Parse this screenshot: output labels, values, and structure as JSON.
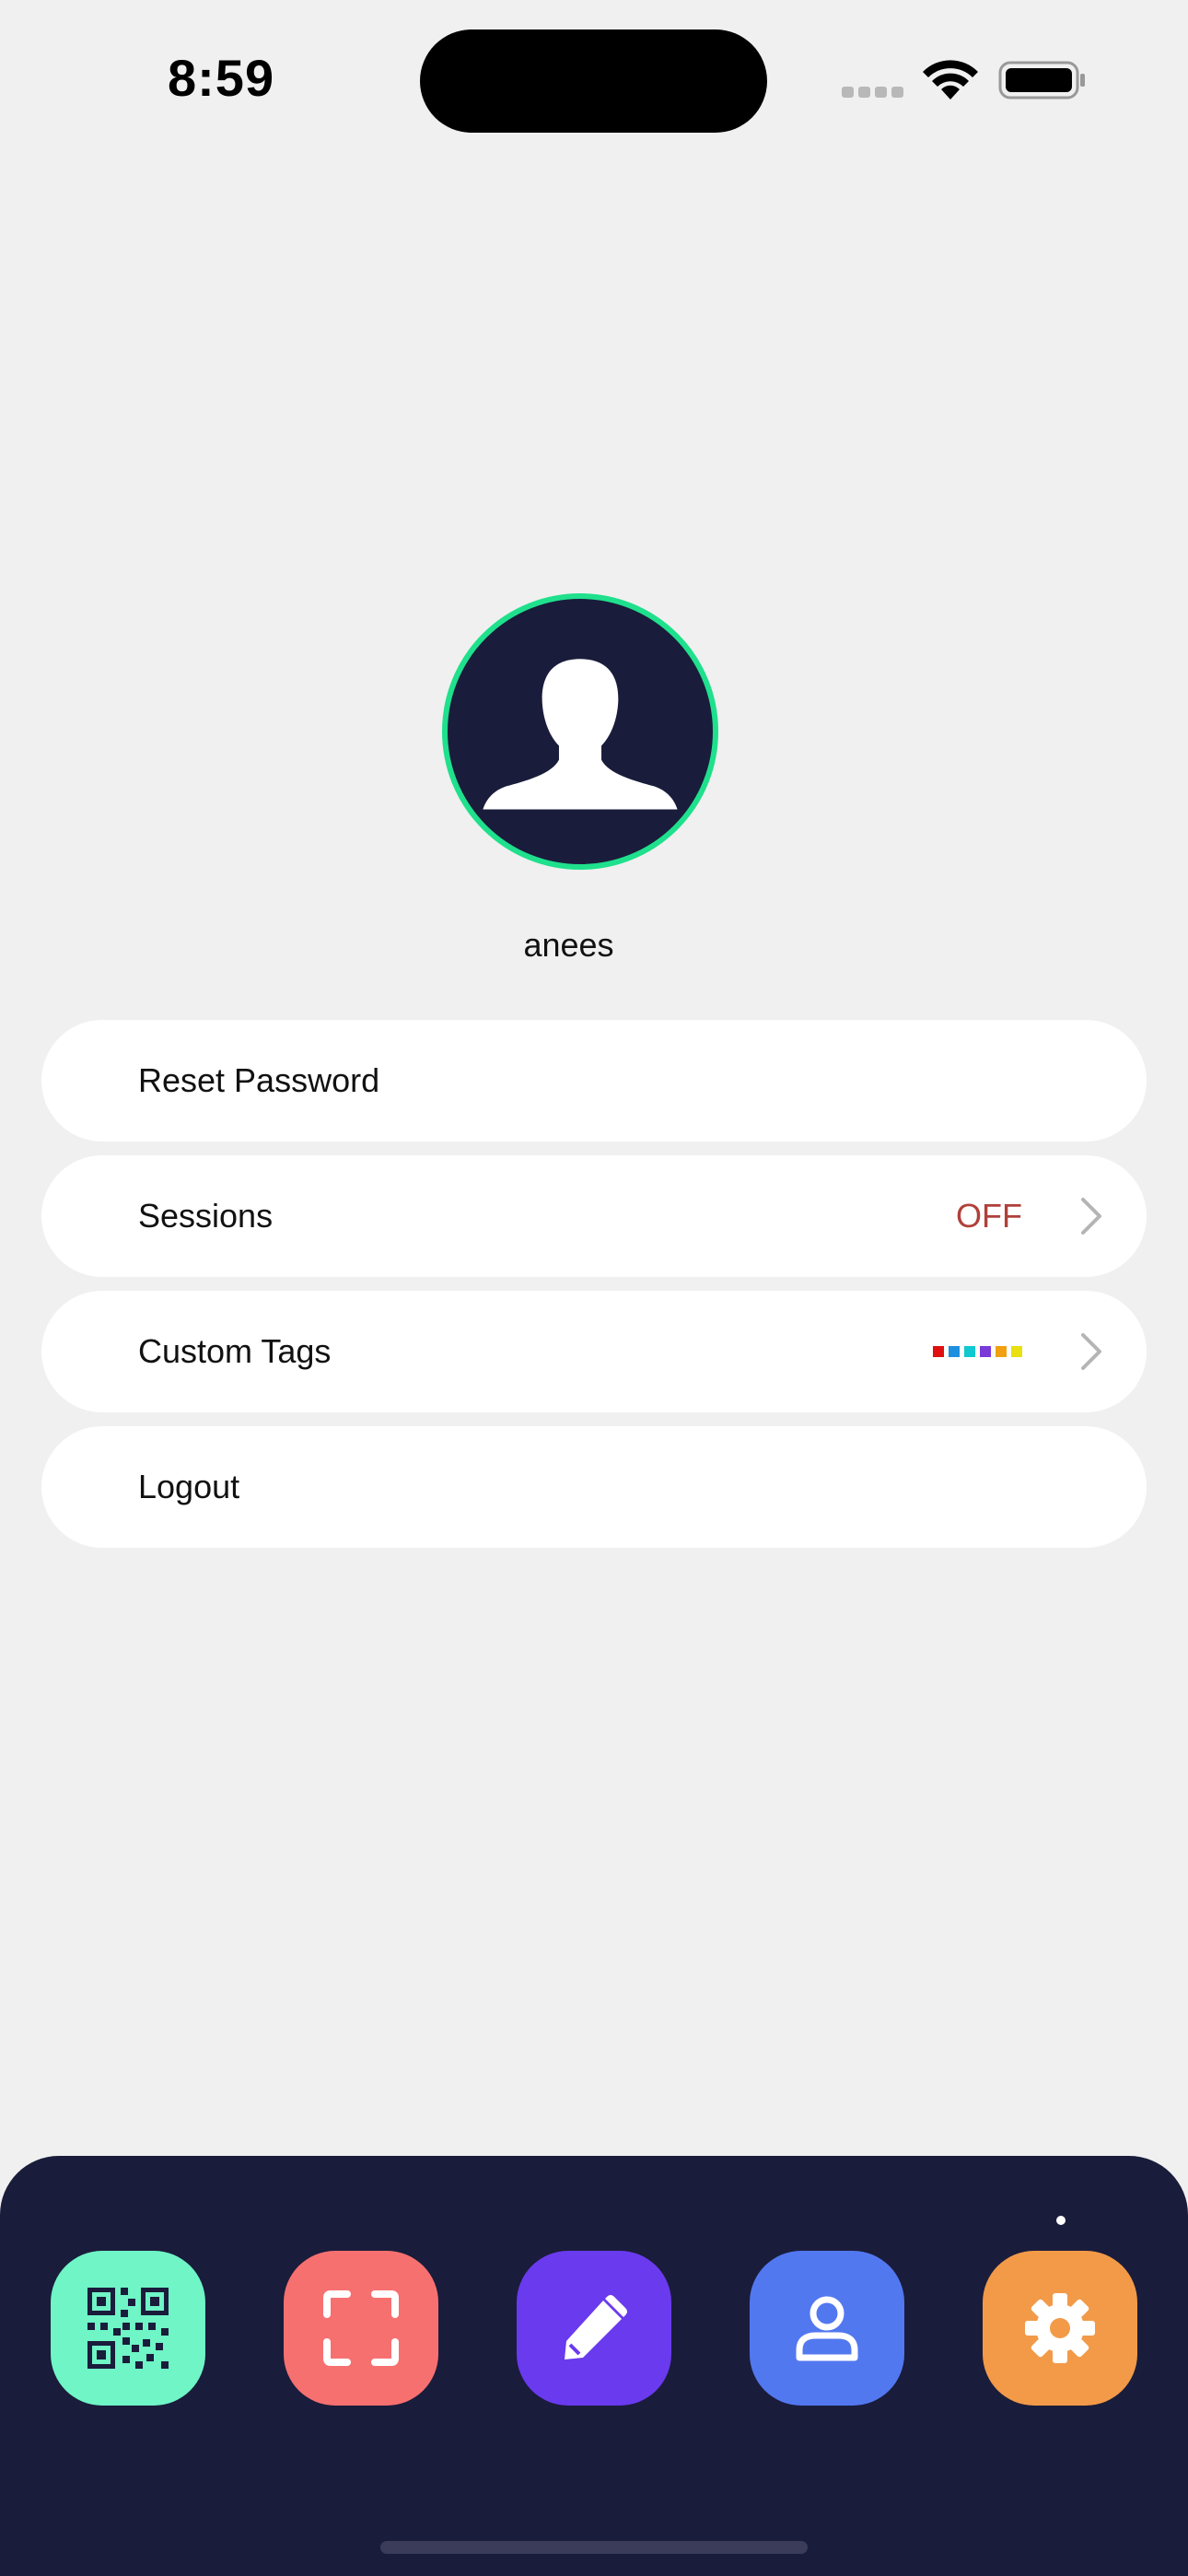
{
  "status_bar": {
    "time": "8:59"
  },
  "profile": {
    "username": "anees",
    "avatar_ring_color": "#1fe08c",
    "avatar_bg_color": "#1a1c3b"
  },
  "menu": {
    "reset_password": {
      "label": "Reset Password"
    },
    "sessions": {
      "label": "Sessions",
      "value": "OFF",
      "value_color": "#b0403a"
    },
    "custom_tags": {
      "label": "Custom Tags",
      "tag_colors": [
        "#e01010",
        "#1f8fe0",
        "#10c8d0",
        "#7a3ad8",
        "#f0a010",
        "#e8e010"
      ]
    },
    "logout": {
      "label": "Logout"
    }
  },
  "tab_bar": {
    "tabs": [
      {
        "name": "qr-code",
        "icon": "qr-code-icon",
        "color": "#6ff5c6"
      },
      {
        "name": "scan",
        "icon": "scan-frame-icon",
        "color": "#f77070"
      },
      {
        "name": "edit",
        "icon": "pencil-icon",
        "color": "#6a3aee"
      },
      {
        "name": "profile",
        "icon": "person-icon",
        "color": "#5278f0"
      },
      {
        "name": "settings",
        "icon": "gear-icon",
        "color": "#f29a48"
      }
    ]
  }
}
